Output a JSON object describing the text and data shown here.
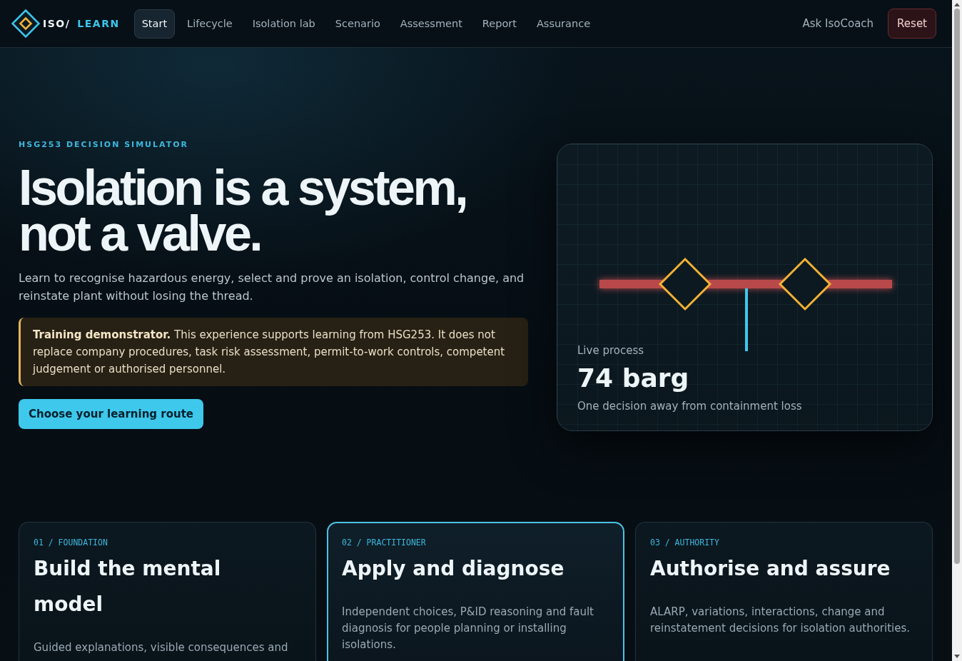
{
  "header": {
    "logo": {
      "prefix": "ISO/",
      "suffix": "LEARN"
    },
    "tabs": [
      {
        "label": "Start",
        "selected": true
      },
      {
        "label": "Lifecycle",
        "selected": false
      },
      {
        "label": "Isolation lab",
        "selected": false
      },
      {
        "label": "Scenario",
        "selected": false
      },
      {
        "label": "Assessment",
        "selected": false
      },
      {
        "label": "Report",
        "selected": false
      },
      {
        "label": "Assurance",
        "selected": false
      }
    ],
    "coach_link": "Ask IsoCoach",
    "reset_button": "Reset"
  },
  "hero": {
    "eyebrow": "HSG253 DECISION SIMULATOR",
    "headline": "Isolation is a system, not a valve.",
    "lead": "Learn to recognise hazardous energy, select and prove an isolation, control change, and reinstate plant without losing the thread.",
    "notice": "**Training demonstrator.** This experience supports learning from HSG253. It does not replace company procedures, task risk assessment, permit-to-work controls, competent judgement or authorised personnel.",
    "cta": "Choose your learning route"
  },
  "process_card": {
    "label": "Live process",
    "value": "74 barg",
    "caption": "One decision away from containment loss"
  },
  "routes": [
    {
      "tag": "01 / FOUNDATION",
      "title": "Build the mental model",
      "description": "Guided explanations, visible consequences and",
      "selected": false
    },
    {
      "tag": "02 / PRACTITIONER",
      "title": "Apply and diagnose",
      "description": "Independent choices, P&ID reasoning and fault diagnosis for people planning or installing isolations.",
      "selected": true
    },
    {
      "tag": "03 / AUTHORITY",
      "title": "Authorise and assure",
      "description": "ALARP, variations, interactions, change and reinstatement decisions for isolation authorities.",
      "selected": false
    }
  ]
}
